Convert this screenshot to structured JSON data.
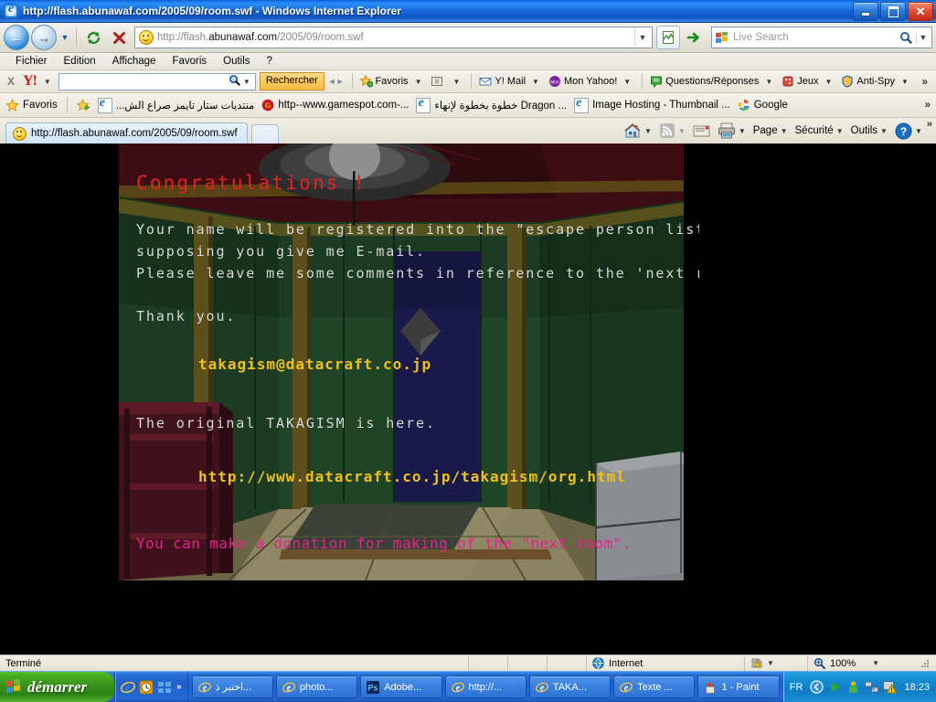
{
  "window": {
    "title": "http://flash.abunawaf.com/2005/09/room.swf - Windows Internet Explorer",
    "minimize_label": "",
    "maximize_label": "",
    "close_label": "✕"
  },
  "navbar": {
    "back_glyph": "←",
    "forward_glyph": "→",
    "recent_glyph": "▼",
    "refresh_name": "refresh",
    "stop_name": "stop",
    "address_url_prefix": "http://flash.",
    "address_url_bold": "abunawaf.com",
    "address_url_suffix": "/2005/09/room.swf",
    "address_dropdown_glyph": "▼",
    "compat_glyph": "",
    "go_glyph": "➜",
    "search_placeholder": "Live Search",
    "search_dropdown_glyph": "▼"
  },
  "menubar": {
    "items": [
      "Fichier",
      "Edition",
      "Affichage",
      "Favoris",
      "Outils",
      "?"
    ]
  },
  "yahoo_toolbar": {
    "close_label": "X",
    "logo_label": "Y!",
    "logo_caret": "▼",
    "search_value": "",
    "search_button": "Rechercher",
    "items": [
      {
        "label": "Favoris",
        "caret": "▼",
        "icon": "favorites-star-icon"
      },
      {
        "label": "",
        "caret": "▼",
        "icon": "card-icon"
      },
      {
        "label": "Y! Mail",
        "caret": "▼",
        "icon": "mail-envelope-icon"
      },
      {
        "label": "Mon Yahoo!",
        "caret": "▼",
        "icon": "my-yahoo-icon"
      },
      {
        "label": "Questions/Réponses",
        "caret": "▼",
        "icon": "answers-icon"
      },
      {
        "label": "Jeux",
        "caret": "▼",
        "icon": "dice-icon"
      },
      {
        "label": "Anti-Spy",
        "caret": "▼",
        "icon": "shield-icon"
      }
    ],
    "overflow_glyph": "»"
  },
  "favorites_bar": {
    "label": "Favoris",
    "items": [
      {
        "label": "منتديات ستار تايمز صراع الش...",
        "icon": "ie-page-icon"
      },
      {
        "label": "http--www.gamespot.com-...",
        "icon": "gamespot-icon"
      },
      {
        "label": "خطوة بخطوة لإنهاء Dragon ...",
        "icon": "ie-page-icon"
      },
      {
        "label": "Image Hosting - Thumbnail ...",
        "icon": "ie-page-icon"
      },
      {
        "label": "Google",
        "icon": "google-icon"
      }
    ],
    "overflow_glyph": "»"
  },
  "tabs": {
    "items": [
      {
        "label": "http://flash.abunawaf.com/2005/09/room.swf",
        "active": true
      }
    ],
    "new_tab_label": ""
  },
  "command_bar": {
    "items": [
      {
        "label": "",
        "icon": "home-icon",
        "caret": "▼"
      },
      {
        "label": "",
        "icon": "rss-feed-icon",
        "caret": "▼"
      },
      {
        "label": "",
        "icon": "read-mail-icon",
        "caret": ""
      },
      {
        "label": "",
        "icon": "printer-icon",
        "caret": "▼"
      },
      {
        "label": "Page",
        "icon": "",
        "caret": "▼"
      },
      {
        "label": "Sécurité",
        "icon": "",
        "caret": "▼"
      },
      {
        "label": "Outils",
        "icon": "",
        "caret": "▼"
      },
      {
        "label": "",
        "icon": "help-icon",
        "caret": "▼"
      }
    ],
    "overflow_glyph": "»"
  },
  "flash_content": {
    "title": "Congratulations !",
    "line1": "Your name will be registered into the \"escape person list\"",
    "line2": "supposing you give me E-mail.",
    "line3": "Please leave me some comments in reference to the 'next room'",
    "thanks": "Thank you.",
    "email": "takagism@datacraft.co.jp",
    "original_note": "The original TAKAGISM is here.",
    "url": "http://www.datacraft.co.jp/takagism/org.html",
    "donation": "You can make a donation for making of the \"next room\".",
    "colors": {
      "title": "#e02424",
      "body": "#d8d8d8",
      "link": "#f0c118",
      "donation": "#ec1f8f",
      "background": "#000000",
      "wall_green": "#1f4426",
      "wall_dark": "#133018",
      "door_blue": "#181a4a",
      "shelf_red": "#40121b",
      "floor_tan": "#8a8461",
      "fridge_gray": "#868a8e",
      "ceiling_red": "#3c0d12",
      "beam_olive": "#6b5c1e"
    }
  },
  "status_bar": {
    "text": "Terminé",
    "zone": "Internet",
    "zone_icon": "globe-icon",
    "protected_icon": "protected-mode-icon",
    "protected_caret": "▼",
    "zoom_icon": "zoom-icon",
    "zoom_level": "100%",
    "zoom_caret": "▼"
  },
  "taskbar": {
    "start_label": "démarrer",
    "quick_launch": [
      {
        "icon": "ie-icon",
        "name": "internet-explorer"
      },
      {
        "icon": "clock-icon",
        "name": "clock-app"
      },
      {
        "icon": "windows-icon",
        "name": "show-desktop"
      }
    ],
    "quick_launch_chevron": "»",
    "tasks": [
      {
        "label": "اختبر ذ...",
        "icon": "ie-icon"
      },
      {
        "label": "photo...",
        "icon": "ie-icon"
      },
      {
        "label": "Adobe...",
        "icon": "photoshop-icon"
      },
      {
        "label": "http://...",
        "icon": "ie-icon"
      },
      {
        "label": "TAKA...",
        "icon": "ie-icon"
      },
      {
        "label": "Texte ...",
        "icon": "ie-icon"
      },
      {
        "label": "1 - Paint",
        "icon": "paint-icon"
      }
    ],
    "language": "FR",
    "tray": [
      {
        "icon": "show-hidden-icon",
        "name": "show-hidden-arrow"
      },
      {
        "icon": "media-play-icon",
        "name": "media-player"
      },
      {
        "icon": "messenger-icon",
        "name": "messenger"
      },
      {
        "icon": "network-icon",
        "name": "network"
      },
      {
        "icon": "warning-icon",
        "name": "security-alert"
      }
    ],
    "clock": "18:23"
  }
}
